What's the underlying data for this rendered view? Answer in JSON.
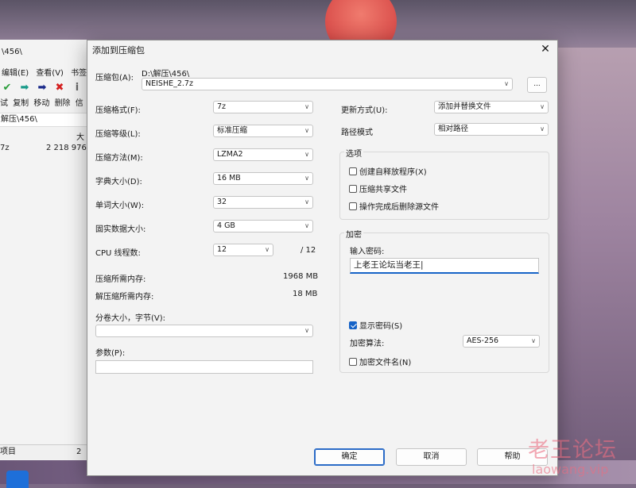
{
  "background_window": {
    "path_fragment": "\\456\\",
    "menus": [
      "编辑(E)",
      "查看(V)",
      "书签"
    ],
    "toolbar_labels": [
      "试",
      "复制",
      "移动",
      "删除",
      "信"
    ],
    "address": "解压\\456\\",
    "column_header": "大",
    "row_name": "7z",
    "row_size": "2 218 976",
    "status_left": "项目",
    "status_right": "2"
  },
  "dialog": {
    "title": "添加到压缩包",
    "archive_label": "压缩包(A):",
    "archive_path": "D:\\解压\\456\\",
    "archive_name": "NEISHE_2.7z",
    "browse_label": "...",
    "format_label": "压缩格式(F):",
    "format_value": "7z",
    "level_label": "压缩等级(L):",
    "level_value": "标准压缩",
    "method_label": "压缩方法(M):",
    "method_value": "LZMA2",
    "dict_label": "字典大小(D):",
    "dict_value": "16 MB",
    "word_label": "单词大小(W):",
    "word_value": "32",
    "solid_label": "固实数据大小:",
    "solid_value": "4 GB",
    "threads_label": "CPU 线程数:",
    "threads_value": "12",
    "threads_total": "/ 12",
    "mem_comp_label": "压缩所需内存:",
    "mem_comp_value": "1968 MB",
    "mem_decomp_label": "解压缩所需内存:",
    "mem_decomp_value": "18 MB",
    "split_label": "分卷大小，字节(V):",
    "split_value": "",
    "params_label": "参数(P):",
    "params_value": "",
    "update_label": "更新方式(U):",
    "update_value": "添加并替换文件",
    "pathmode_label": "路径模式",
    "pathmode_value": "相对路径",
    "options_title": "选项",
    "opt_sfx": "创建自释放程序(X)",
    "opt_shared": "压缩共享文件",
    "opt_delete": "操作完成后删除源文件",
    "encryption_title": "加密",
    "password_label": "输入密码:",
    "password_value": "上老王论坛当老王|",
    "show_password": "显示密码(S)",
    "enc_method_label": "加密算法:",
    "enc_method_value": "AES-256",
    "encrypt_names": "加密文件名(N)",
    "ok": "确定",
    "cancel": "取消",
    "help": "帮助"
  },
  "checks": {
    "sfx": false,
    "shared": false,
    "delete": false,
    "show_password": true,
    "encrypt_names": false
  },
  "watermark": {
    "name": "老王论坛",
    "domain": "laowang.vip"
  }
}
